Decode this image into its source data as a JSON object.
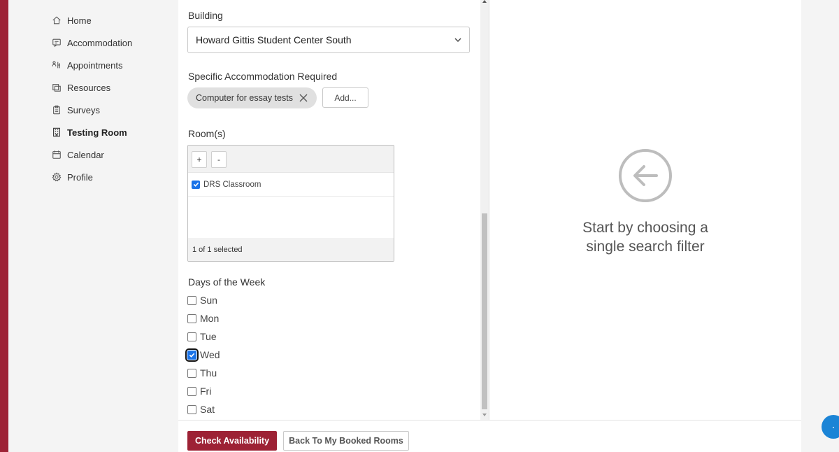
{
  "sidebar": {
    "items": [
      {
        "label": "Home",
        "icon": "home-icon"
      },
      {
        "label": "Accommodation",
        "icon": "chat-icon"
      },
      {
        "label": "Appointments",
        "icon": "appointments-icon"
      },
      {
        "label": "Resources",
        "icon": "folder-icon"
      },
      {
        "label": "Surveys",
        "icon": "clipboard-icon"
      },
      {
        "label": "Testing Room",
        "icon": "building-icon",
        "active": true
      },
      {
        "label": "Calendar",
        "icon": "calendar-icon"
      },
      {
        "label": "Profile",
        "icon": "gear-icon"
      }
    ]
  },
  "form": {
    "building_label": "Building",
    "building_value": "Howard Gittis Student Center South",
    "accommodation_label": "Specific Accommodation Required",
    "accommodation_chip": "Computer for essay tests",
    "add_button": "Add...",
    "rooms_label": "Room(s)",
    "rooms_toolbar": {
      "expand": "+",
      "collapse": "-"
    },
    "rooms": [
      {
        "name": "DRS Classroom",
        "checked": true
      }
    ],
    "rooms_footer": "1 of 1 selected",
    "days_label": "Days of the Week",
    "days": [
      {
        "label": "Sun",
        "checked": false
      },
      {
        "label": "Mon",
        "checked": false
      },
      {
        "label": "Tue",
        "checked": false
      },
      {
        "label": "Wed",
        "checked": true
      },
      {
        "label": "Thu",
        "checked": false
      },
      {
        "label": "Fri",
        "checked": false
      },
      {
        "label": "Sat",
        "checked": false
      }
    ]
  },
  "results": {
    "empty_line1": "Start by choosing a",
    "empty_line2": "single search filter"
  },
  "footer": {
    "check_button": "Check Availability",
    "back_button": "Back To My Booked Rooms"
  },
  "colors": {
    "brand": "#9d2235",
    "checkbox_accent": "#1a73e8",
    "badge": "#1b84d6"
  }
}
